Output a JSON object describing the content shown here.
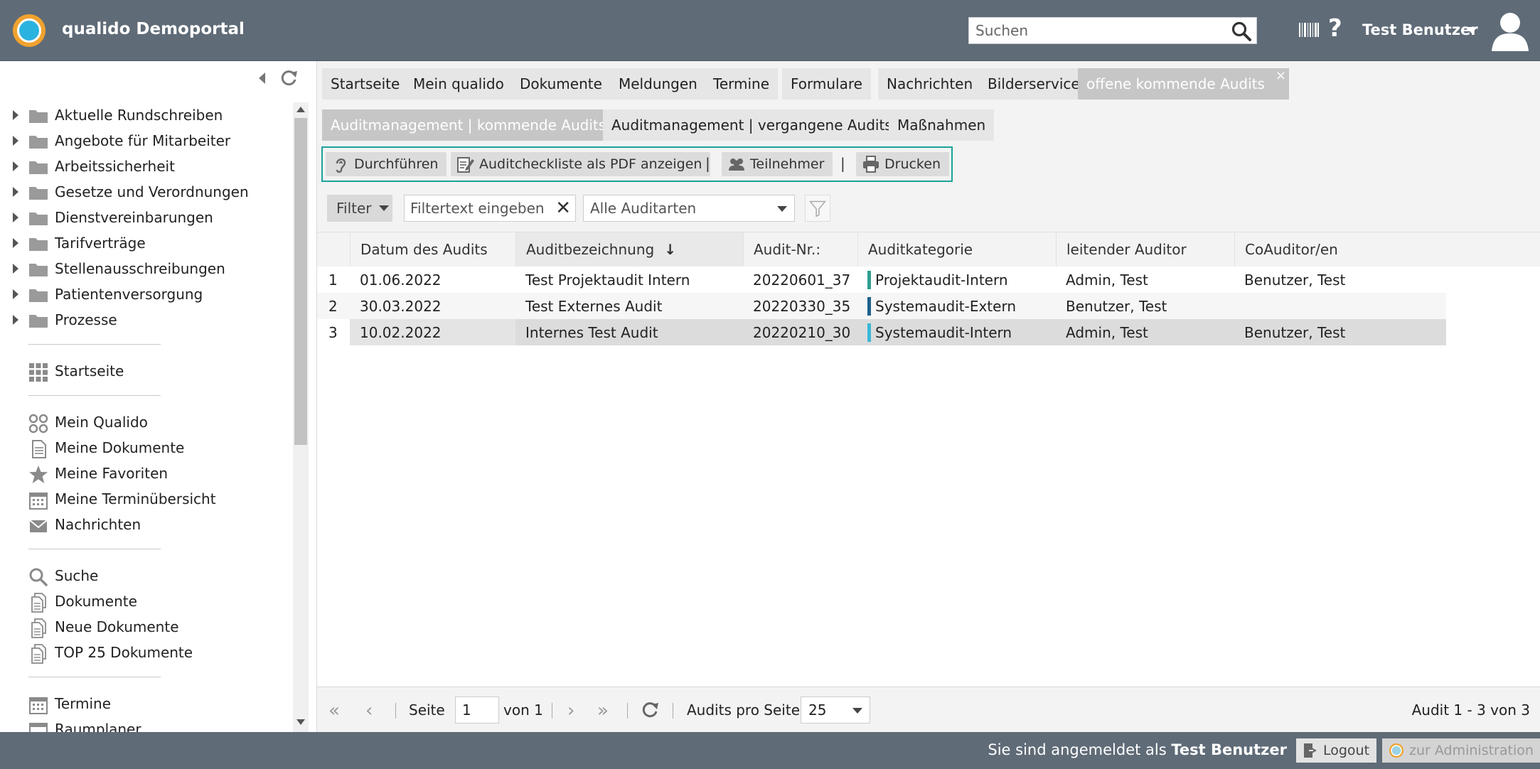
{
  "header": {
    "app_title": "qualido Demoportal",
    "search_placeholder": "Suchen",
    "help_label": "?",
    "user_name": "Test Benutzer"
  },
  "sidebar": {
    "folders": [
      {
        "label": "Aktuelle Rundschreiben"
      },
      {
        "label": "Angebote für Mitarbeiter"
      },
      {
        "label": "Arbeitssicherheit"
      },
      {
        "label": "Gesetze und Verordnungen"
      },
      {
        "label": "Dienstvereinbarungen"
      },
      {
        "label": "Tarifverträge"
      },
      {
        "label": "Stellenausschreibungen"
      },
      {
        "label": "Patientenversorgung"
      },
      {
        "label": "Prozesse"
      }
    ],
    "group1": [
      {
        "label": "Startseite",
        "icon": "grid-icon"
      }
    ],
    "group2": [
      {
        "label": "Mein Qualido",
        "icon": "qualido-icon"
      },
      {
        "label": "Meine Dokumente",
        "icon": "document-icon"
      },
      {
        "label": "Meine Favoriten",
        "icon": "star-icon"
      },
      {
        "label": "Meine Terminübersicht",
        "icon": "calendar-icon"
      },
      {
        "label": "Nachrichten",
        "icon": "mail-icon"
      }
    ],
    "group3": [
      {
        "label": "Suche",
        "icon": "search-icon"
      },
      {
        "label": "Dokumente",
        "icon": "documents-icon"
      },
      {
        "label": "Neue Dokumente",
        "icon": "documents-icon"
      },
      {
        "label": "TOP 25 Dokumente",
        "icon": "documents-icon"
      }
    ],
    "group4": [
      {
        "label": "Termine",
        "icon": "calendar-icon"
      },
      {
        "label": "Raumplaner",
        "icon": "calendar-icon"
      }
    ]
  },
  "tabs": {
    "top": [
      {
        "label": "Startseite"
      },
      {
        "label": "Mein qualido"
      },
      {
        "label": "Dokumente"
      },
      {
        "label": "Meldungen"
      },
      {
        "label": "Termine"
      },
      {
        "label": "Formulare"
      },
      {
        "label": "Nachrichten"
      },
      {
        "label": "Bilderservice"
      },
      {
        "label": "offene kommende Audits",
        "active": true,
        "close": "×"
      }
    ],
    "sub": [
      {
        "label": "Auditmanagement | kommende Audits",
        "active": true
      },
      {
        "label": "Auditmanagement | vergangene Audits"
      },
      {
        "label": "Maßnahmen"
      }
    ]
  },
  "toolbar": {
    "execute": "Durchführen",
    "pdf": "Auditcheckliste als PDF anzeigen",
    "participants": "Teilnehmer",
    "print": "Drucken",
    "separator": "|"
  },
  "filter": {
    "button": "Filter",
    "placeholder": "Filtertext eingeben",
    "clear": "✕",
    "audit_types": "Alle Auditarten"
  },
  "grid": {
    "columns": [
      "Datum des Audits",
      "Auditbezeichnung",
      "Audit-Nr.:",
      "Auditkategorie",
      "leitender Auditor",
      "CoAuditor/en"
    ],
    "sort_indicator": "↓",
    "rows": [
      {
        "n": "1",
        "date": "01.06.2022",
        "name": "Test Projektaudit Intern",
        "nr": "20220601_37",
        "category": "Projektaudit-Intern",
        "cat_color": "#2f9e8f",
        "lead": "Admin, Test",
        "co": "Benutzer, Test"
      },
      {
        "n": "2",
        "date": "30.03.2022",
        "name": "Test Externes Audit",
        "nr": "20220330_35",
        "category": "Systemaudit-Extern",
        "cat_color": "#1f5f8b",
        "lead": "Benutzer, Test",
        "co": ""
      },
      {
        "n": "3",
        "date": "10.02.2022",
        "name": "Internes Test Audit",
        "nr": "20220210_30",
        "category": "Systemaudit-Intern",
        "cat_color": "#3bb7d6",
        "lead": "Admin, Test",
        "co": "Benutzer, Test"
      }
    ]
  },
  "pager": {
    "first": "«",
    "prev": "‹",
    "page_label": "Seite",
    "page": "1",
    "of_label": "von 1",
    "next": "›",
    "last": "»",
    "per_page_label": "Audits pro Seite:",
    "per_page": "25",
    "summary": "Audit 1 - 3 von 3"
  },
  "footer": {
    "logged_in_prefix": "Sie sind angemeldet als",
    "logged_in_user": "Test Benutzer",
    "logout": "Logout",
    "admin": "zur Administration"
  }
}
